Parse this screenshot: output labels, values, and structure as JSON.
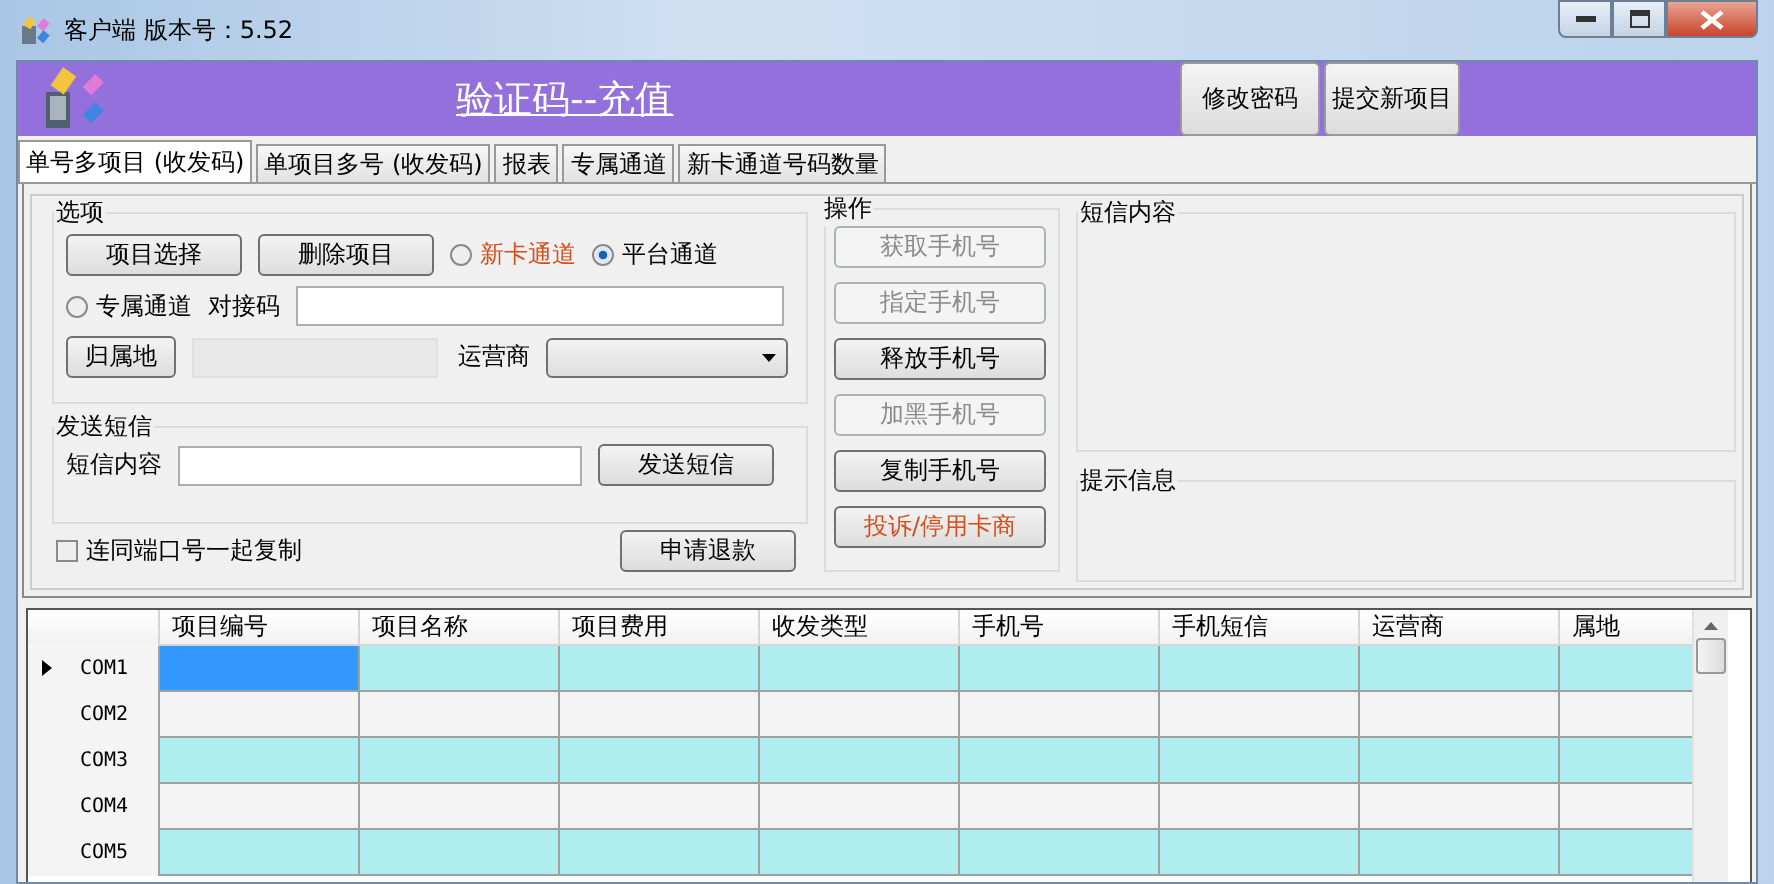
{
  "window": {
    "title": "客户端 版本号：5.52"
  },
  "header": {
    "title": "验证码--充值",
    "buttons": [
      "修改密码",
      "提交新项目"
    ]
  },
  "tabs": [
    {
      "label": "单号多项目 (收发码)",
      "selected": true
    },
    {
      "label": "单项目多号 (收发码)",
      "selected": false
    },
    {
      "label": "报表",
      "selected": false
    },
    {
      "label": "专属通道",
      "selected": false
    },
    {
      "label": "新卡通道号码数量",
      "selected": false
    }
  ],
  "options": {
    "title": "选项",
    "buttons": [
      "项目选择",
      "删除项目"
    ],
    "channels": [
      {
        "label": "新卡通道",
        "selected": false,
        "color": "#d2501e"
      },
      {
        "label": "平台通道",
        "selected": true,
        "color": "#000000"
      },
      {
        "label": "专属通道",
        "selected": false,
        "color": "#000000"
      }
    ],
    "dock_code_label": "对接码",
    "location_button": "归属地",
    "carrier_label": "运营商"
  },
  "send_sms": {
    "title": "发送短信",
    "content_label": "短信内容",
    "send_button": "发送短信"
  },
  "copy_with_port": {
    "label": "连同端口号一起复制",
    "checked": false
  },
  "refund_button": "申请退款",
  "operations": {
    "title": "操作",
    "buttons": [
      {
        "label": "获取手机号",
        "disabled": true,
        "kind": "normal"
      },
      {
        "label": "指定手机号",
        "disabled": true,
        "kind": "normal"
      },
      {
        "label": "释放手机号",
        "disabled": false,
        "kind": "normal"
      },
      {
        "label": "加黑手机号",
        "disabled": true,
        "kind": "normal"
      },
      {
        "label": "复制手机号",
        "disabled": false,
        "kind": "normal"
      },
      {
        "label": "投诉/停用卡商",
        "disabled": false,
        "kind": "warning"
      }
    ]
  },
  "sms_panel": {
    "title": "短信内容"
  },
  "hint_panel": {
    "title": "提示信息"
  },
  "grid": {
    "columns": [
      "项目编号",
      "项目名称",
      "项目费用",
      "收发类型",
      "手机号",
      "手机短信",
      "运营商",
      "属地"
    ],
    "rows": [
      {
        "label": "COM1",
        "selected": true
      },
      {
        "label": "COM2",
        "selected": false
      },
      {
        "label": "COM3",
        "selected": false
      },
      {
        "label": "COM4",
        "selected": false
      },
      {
        "label": "COM5",
        "selected": false
      }
    ]
  }
}
